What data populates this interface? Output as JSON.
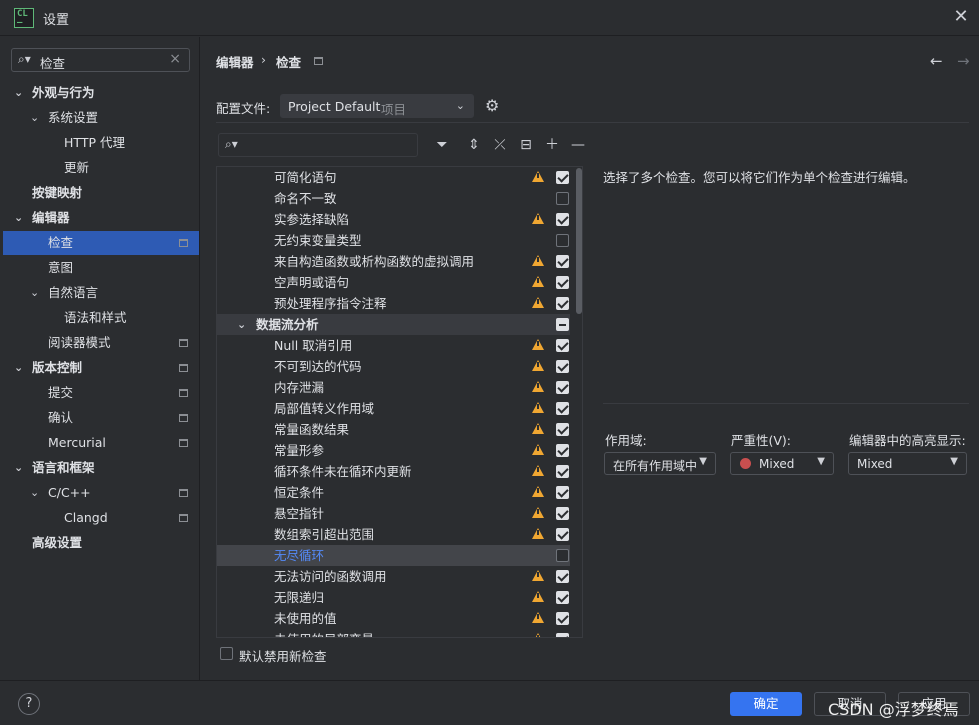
{
  "window": {
    "title": "设置",
    "logo_text": [
      "CL",
      "—"
    ]
  },
  "sidebar": {
    "search_value": "检查",
    "items": [
      {
        "label": "外观与行为",
        "chevron": "⌄"
      },
      {
        "label": "系统设置",
        "chevron": "⌄"
      },
      {
        "label": "HTTP 代理"
      },
      {
        "label": "更新"
      },
      {
        "label": "按键映射"
      },
      {
        "label": "编辑器",
        "chevron": "⌄"
      },
      {
        "label": "检查"
      },
      {
        "label": "意图"
      },
      {
        "label": "自然语言",
        "chevron": "⌄"
      },
      {
        "label": "语法和样式"
      },
      {
        "label": "阅读器模式"
      },
      {
        "label": "版本控制",
        "chevron": "⌄"
      },
      {
        "label": "提交"
      },
      {
        "label": "确认"
      },
      {
        "label": "Mercurial"
      },
      {
        "label": "语言和框架",
        "chevron": "⌄"
      },
      {
        "label": "C/C++",
        "chevron": "⌄"
      },
      {
        "label": "Clangd"
      },
      {
        "label": "高级设置"
      }
    ]
  },
  "header": {
    "breadcrumb": [
      "编辑器",
      "›",
      "检查"
    ],
    "nav_back": "←",
    "nav_forward": "→"
  },
  "profile": {
    "label": "配置文件:",
    "value": "Project Default",
    "scope": "项目"
  },
  "inspections": {
    "rows": [
      {
        "label": "可简化语句",
        "warn": true,
        "state": "on"
      },
      {
        "label": "命名不一致",
        "warn": false,
        "state": "off"
      },
      {
        "label": "实参选择缺陷",
        "warn": true,
        "state": "on"
      },
      {
        "label": "无约束变量类型",
        "warn": false,
        "state": "off"
      },
      {
        "label": "来自构造函数或析构函数的虚拟调用",
        "warn": true,
        "state": "on"
      },
      {
        "label": "空声明或语句",
        "warn": true,
        "state": "on"
      },
      {
        "label": "预处理程序指令注释",
        "warn": true,
        "state": "on"
      },
      {
        "label": "数据流分析",
        "group": true,
        "chevron": "⌄",
        "state": "mixed"
      },
      {
        "label": "Null 取消引用",
        "warn": true,
        "state": "on"
      },
      {
        "label": "不可到达的代码",
        "warn": true,
        "state": "on"
      },
      {
        "label": "内存泄漏",
        "warn": true,
        "state": "on"
      },
      {
        "label": "局部值转义作用域",
        "warn": true,
        "state": "on"
      },
      {
        "label": "常量函数结果",
        "warn": true,
        "state": "on"
      },
      {
        "label": "常量形参",
        "warn": true,
        "state": "on"
      },
      {
        "label": "循环条件未在循环内更新",
        "warn": true,
        "state": "on"
      },
      {
        "label": "恒定条件",
        "warn": true,
        "state": "on"
      },
      {
        "label": "悬空指针",
        "warn": true,
        "state": "on"
      },
      {
        "label": "数组索引超出范围",
        "warn": true,
        "state": "on"
      },
      {
        "label": "无尽循环",
        "warn": false,
        "state": "off",
        "selected": true
      },
      {
        "label": "无法访问的函数调用",
        "warn": true,
        "state": "on"
      },
      {
        "label": "无限递归",
        "warn": true,
        "state": "on"
      },
      {
        "label": "未使用的值",
        "warn": true,
        "state": "on"
      },
      {
        "label": "未使用的局部变量",
        "warn": true,
        "state": "on"
      }
    ],
    "default_disable_label": "默认禁用新检查"
  },
  "details": {
    "description": "选择了多个检查。您可以将它们作为单个检查进行编辑。",
    "scope_label": "作用域:",
    "scope_value": "在所有作用域中",
    "severity_label": "严重性(V):",
    "severity_value": "Mixed",
    "highlight_label": "编辑器中的高亮显示:",
    "highlight_value": "Mixed"
  },
  "footer": {
    "help": "?",
    "ok": "确定",
    "cancel": "取消",
    "apply": "应用",
    "watermark": "CSDN @浮梦终焉"
  },
  "colors": {
    "accent": "#3574f0",
    "warning": "#f0a732",
    "selected_text": "#548af7"
  }
}
